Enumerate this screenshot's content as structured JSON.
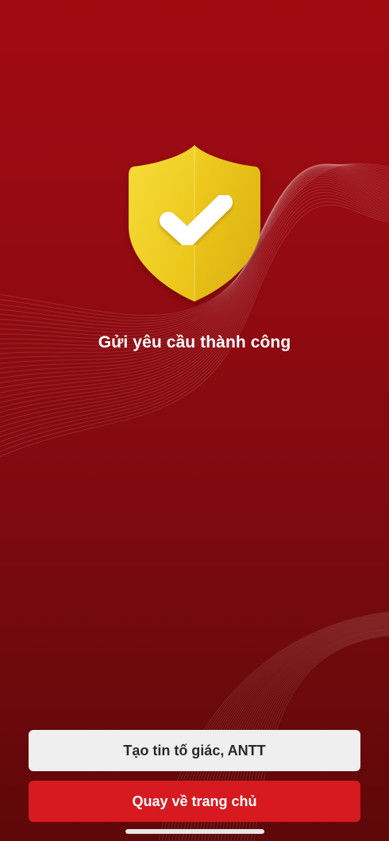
{
  "colors": {
    "background_top": "#a20a12",
    "background_bottom": "#5e0809",
    "shield": "#f3d21f",
    "primary_button": "#d71920",
    "secondary_button": "#efefef"
  },
  "icon": "shield-check-icon",
  "status": {
    "title": "Gửi yêu cầu thành công"
  },
  "actions": {
    "report_label": "Tạo tin tố giác, ANTT",
    "home_label": "Quay về trang chủ"
  }
}
